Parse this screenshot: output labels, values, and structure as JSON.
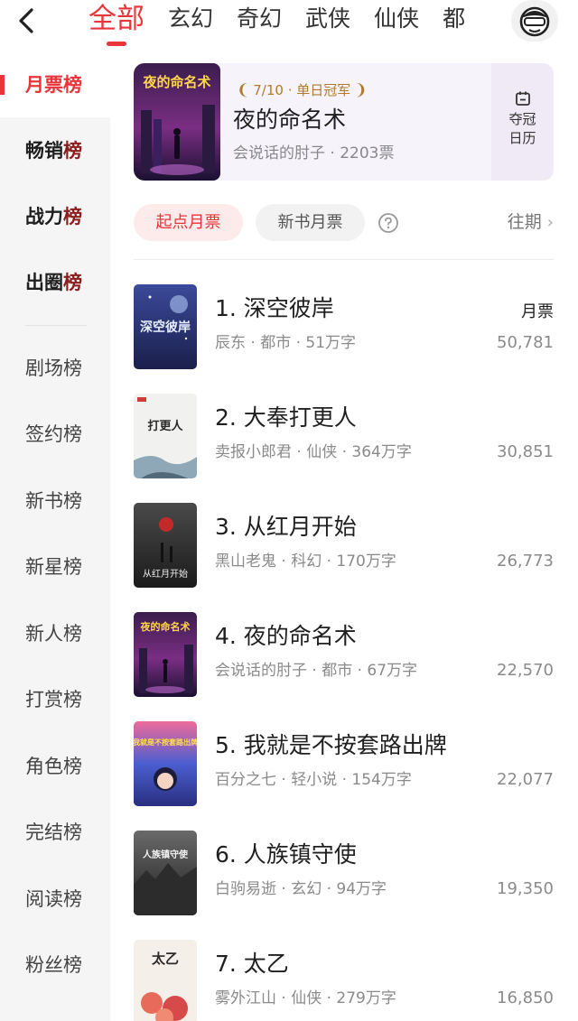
{
  "topbar": {
    "categories": [
      {
        "label": "全部",
        "active": true
      },
      {
        "label": "玄幻"
      },
      {
        "label": "奇幻"
      },
      {
        "label": "武侠"
      },
      {
        "label": "仙侠"
      },
      {
        "label": "都"
      }
    ],
    "back_icon": "chevron-left-icon",
    "avatar_icon": "avatar-icon"
  },
  "sidebar": {
    "items": [
      {
        "head": "月票",
        "tail": "榜",
        "active": true
      },
      {
        "head": "畅销",
        "tail": "榜",
        "bold": true
      },
      {
        "head": "战力",
        "tail": "榜",
        "bold": true
      },
      {
        "head": "出圈",
        "tail": "榜",
        "bold": true
      },
      {
        "head": "剧场",
        "tail": "榜"
      },
      {
        "head": "签约",
        "tail": "榜"
      },
      {
        "head": "新书",
        "tail": "榜"
      },
      {
        "head": "新星",
        "tail": "榜"
      },
      {
        "head": "新人",
        "tail": "榜"
      },
      {
        "head": "打赏",
        "tail": "榜"
      },
      {
        "head": "角色",
        "tail": "榜"
      },
      {
        "head": "完结",
        "tail": "榜"
      },
      {
        "head": "阅读",
        "tail": "榜"
      },
      {
        "head": "粉丝",
        "tail": "榜"
      }
    ]
  },
  "banner": {
    "crown_label": "7/10 · 单日冠军",
    "title": "夜的命名术",
    "meta": "会说话的肘子 · 2203票",
    "calendar_line1": "夺冠",
    "calendar_line2": "日历",
    "cover_text": "夜的命名术"
  },
  "filters": {
    "active_chip": "起点月票",
    "chip2": "新书月票",
    "history": "往期",
    "help_icon": "question-circle-icon"
  },
  "list": {
    "votes_header": "月票",
    "items": [
      {
        "rank_title": "1. 深空彼岸",
        "meta": "辰东 · 都市 · 51万字",
        "votes": "50,781",
        "cover_text": "深空彼岸"
      },
      {
        "rank_title": "2. 大奉打更人",
        "meta": "卖报小郎君 · 仙侠 · 364万字",
        "votes": "30,851",
        "cover_text": "打更人"
      },
      {
        "rank_title": "3. 从红月开始",
        "meta": "黑山老鬼 · 科幻 · 170万字",
        "votes": "26,773",
        "cover_text": "从红月开始"
      },
      {
        "rank_title": "4. 夜的命名术",
        "meta": "会说话的肘子 · 都市 · 67万字",
        "votes": "22,570",
        "cover_text": "夜的命名术"
      },
      {
        "rank_title": "5. 我就是不按套路出牌",
        "meta": "百分之七 · 轻小说 · 154万字",
        "votes": "22,077",
        "cover_text": "我就是不按套路出牌"
      },
      {
        "rank_title": "6. 人族镇守使",
        "meta": "白驹易逝 · 玄幻 · 94万字",
        "votes": "19,350",
        "cover_text": "人族镇守使"
      },
      {
        "rank_title": "7. 太乙",
        "meta": "雾外江山 · 仙侠 · 279万字",
        "votes": "16,850",
        "cover_text": "太乙"
      }
    ]
  },
  "colors": {
    "accent": "#e8343b",
    "sidebar_bg": "#f5f5f5",
    "banner_bg": "#f6f3fb",
    "crown_gold": "#b07a2a"
  }
}
